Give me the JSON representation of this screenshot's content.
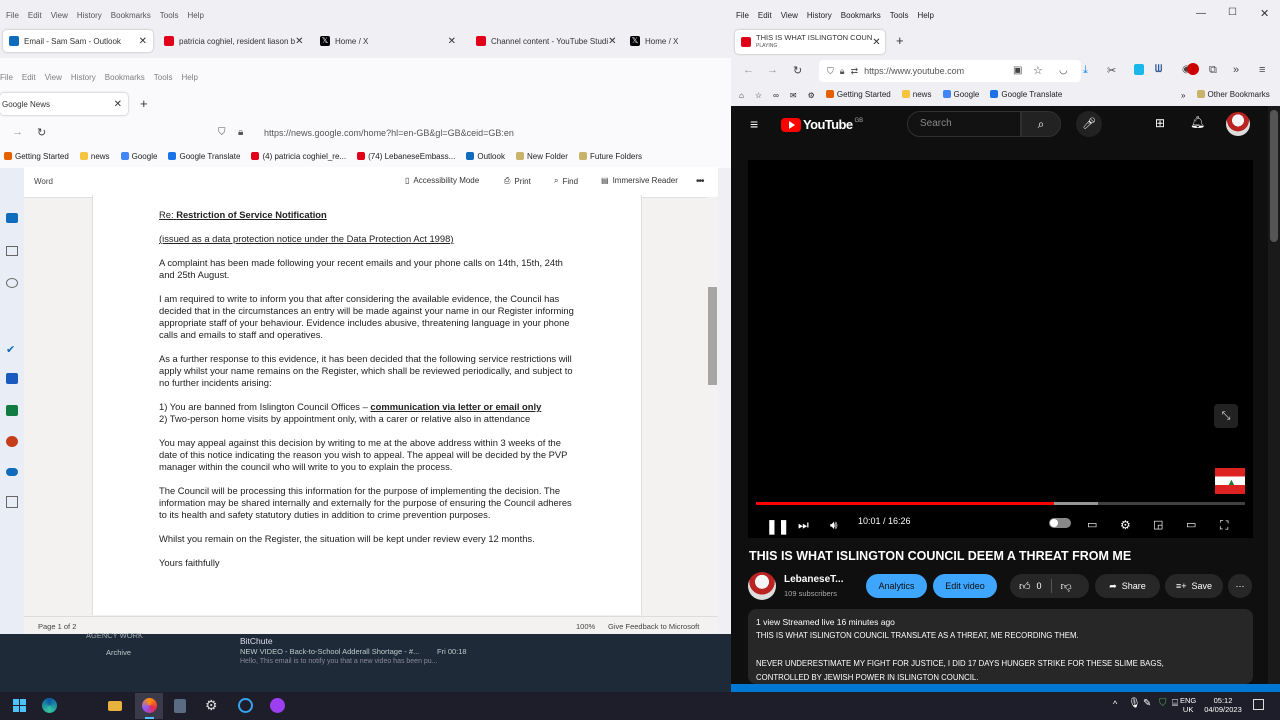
{
  "left_browser": {
    "menu": [
      "File",
      "Edit",
      "View",
      "History",
      "Bookmarks",
      "Tools",
      "Help"
    ],
    "tabs": [
      {
        "label": "Email - Sam Sam - Outlook",
        "color": "#0f6cbd"
      },
      {
        "label": "patricia coghiel, resident liason b",
        "color": "#e1001a"
      },
      {
        "label": "Home / X",
        "color": "#000000"
      },
      {
        "label": "Channel content - YouTube Studi",
        "color": "#e1001a"
      },
      {
        "label": "Home / X",
        "color": "#000000"
      }
    ],
    "inner_menu": [
      "File",
      "Edit",
      "View",
      "History",
      "Bookmarks",
      "Tools",
      "Help"
    ],
    "inner_tab": "Google News",
    "url": "https://news.google.com/home?hl=en-GB&gl=GB&ceid=GB:en",
    "bookmarks": [
      "Getting Started",
      "news",
      "Google",
      "Google Translate",
      "(4) patricia coghiel_re...",
      "(74) LebaneseEmbass...",
      "Outlook",
      "New Folder",
      "Future Folders"
    ]
  },
  "word": {
    "app_name": "Word",
    "toolbar": {
      "accessibility": "Accessibility Mode",
      "print": "Print",
      "find": "Find",
      "immersive": "Immersive Reader",
      "more": "•••"
    },
    "re_prefix": "Re:",
    "re_title": "Restriction of Service Notification",
    "subtitle": "(issued as a data protection notice under the Data Protection Act 1998)",
    "para1": "A complaint has been made following your recent emails and your phone calls on 14th, 15th, 24th and 25th August.",
    "para2": "I am required to write to inform you that after considering the available evidence, the Council has decided that in the circumstances an entry will be made against your name in our Register informing appropriate staff of your behaviour.  Evidence includes abusive, threatening language in your phone calls and emails to staff and operatives.",
    "para3": "As a further response to this evidence, it has been decided that the following service restrictions will apply whilst your name remains on the Register, which shall be reviewed periodically, and subject to no further incidents arising:",
    "item1_prefix": "1)   You are banned from Islington Council Offices – ",
    "item1_bold": "communication via letter or email only",
    "item2": "2)   Two-person home visits by appointment only, with a carer or relative also in attendance",
    "para4": "You may appeal against this decision by writing to me at the above address within 3 weeks of the date of this notice indicating the reason you wish to appeal.  The appeal will be decided by the PVP manager within the council who will write to you to explain the process.",
    "para5": "The Council will be processing this information for the purpose of implementing the decision. The information may be shared internally and externally for the purpose of ensuring the Council adheres to its health and safety statutory duties in addition to crime prevention purposes.",
    "para6": "Whilst you remain on the Register, the situation will be kept under review every 12 months.",
    "closing": "Yours faithfully",
    "status_page": "Page 1 of 2",
    "status_zoom": "100%",
    "status_feedback": "Give Feedback to Microsoft"
  },
  "desktop_mail": {
    "folder1": "AGENCY WORK",
    "folder2": "Archive",
    "sender": "BitChute",
    "subject": "NEW VIDEO - Back-to-School Adderall Shortage - #...",
    "date": "Fri 00:18",
    "preview": "Hello, This email is to notify you that a new video has been pu..."
  },
  "right_browser": {
    "menu": [
      "File",
      "Edit",
      "View",
      "History",
      "Bookmarks",
      "Tools",
      "Help"
    ],
    "tab_title": "THIS IS WHAT ISLINGTON COUN",
    "tab_sub": "PLAYING",
    "url": "https://www.youtube.com",
    "bookmarks": [
      "Getting Started",
      "news",
      "Google",
      "Google Translate"
    ],
    "other_bookmarks": "Other Bookmarks"
  },
  "youtube": {
    "logo_text": "YouTube",
    "region": "GB",
    "search_placeholder": "Search",
    "time": "10:01 / 16:26",
    "progress": 0.61,
    "buffered": 0.7,
    "title": "THIS IS WHAT ISLINGTON COUNCIL DEEM A THREAT FROM ME",
    "channel": "LebaneseT...",
    "subscribers": "109 subscribers",
    "analytics": "Analytics",
    "edit_video": "Edit video",
    "likes": "0",
    "share": "Share",
    "save": "Save",
    "desc_meta": "1 view  Streamed live 16 minutes ago",
    "desc_line1": "THIS IS WHAT ISLINGTON COUNCIL TRANSLATE AS A THREAT, ME RECORDING THEM.",
    "desc_line2": "NEVER UNDERESTIMATE MY FIGHT FOR JUSTICE, I DID 17 DAYS HUNGER STRIKE FOR THESE SLIME BAGS,",
    "desc_line3": "CONTROLLED BY JEWISH POWER IN ISLINGTON COUNCIL.",
    "accent": "#ff0000",
    "pill_blue": "#3ea6ff"
  },
  "taskbar": {
    "lang1": "ENG",
    "lang2": "UK",
    "time": "05:12",
    "date": "04/09/2023"
  }
}
